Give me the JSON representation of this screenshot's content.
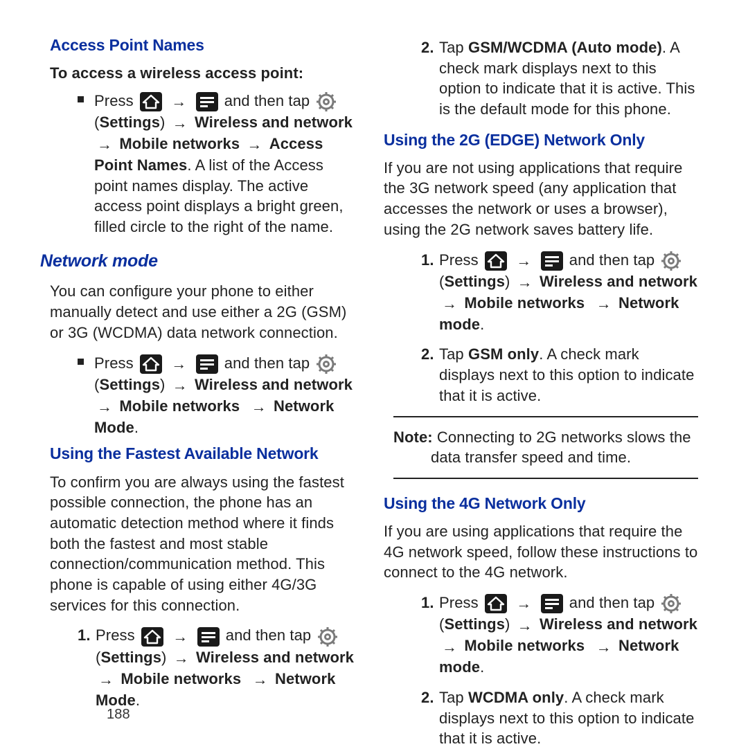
{
  "page_number": "188",
  "left": {
    "apn_heading": "Access Point Names",
    "apn_lead": "To access a wireless access point:",
    "press": "Press",
    "and_then_tap": "and then tap",
    "settings_label": "Settings",
    "wn": "Wireless and network",
    "mn": "Mobile networks",
    "apn_target": "Access Point Names",
    "apn_tail": ". A list of the Access point names display. The active access point displays a bright green, filled circle to the right of the name.",
    "nm_heading": "Network mode",
    "nm_para": "You can configure your phone to either manually detect and use either a 2G (GSM) or 3G (WCDMA) data network connection.",
    "nm_target": "Network Mode",
    "fast_heading": "Using the Fastest Available Network",
    "fast_para": "To confirm you are always using the fastest possible connection, the phone has an automatic detection method where it finds both the fastest and most stable connection/communication method. This phone is capable of using either 4G/3G services for this connection."
  },
  "right": {
    "auto_step2a": "Tap ",
    "auto_step2_bold": "GSM/WCDMA (Auto mode)",
    "auto_step2b": ". A check mark displays next to this option to indicate that it is active. This is the default mode for this phone.",
    "edge_heading": "Using the 2G (EDGE) Network Only",
    "edge_para": "If you are not using applications that require the 3G network speed (any application that accesses the network or uses a browser), using the 2G network saves battery life.",
    "nm_target2": "Network mode",
    "gsm_step2a": "Tap ",
    "gsm_step2_bold": "GSM only",
    "gsm_step2b": ". A check mark displays next to this option to indicate that it is active.",
    "note_label": "Note:",
    "note_text": " Connecting to 2G networks slows the data transfer speed and time.",
    "g4_heading": "Using the 4G Network Only",
    "g4_para": "If you are using applications that require the 4G network speed, follow these instructions to connect to the 4G network.",
    "wcdma_step2a": "Tap ",
    "wcdma_step2_bold": "WCDMA only",
    "wcdma_step2b": ". A check mark displays next to this option to indicate that it is active."
  },
  "icons": {
    "home": "home-icon",
    "menu": "menu-icon",
    "gear": "gear-icon",
    "arrow": "→"
  }
}
